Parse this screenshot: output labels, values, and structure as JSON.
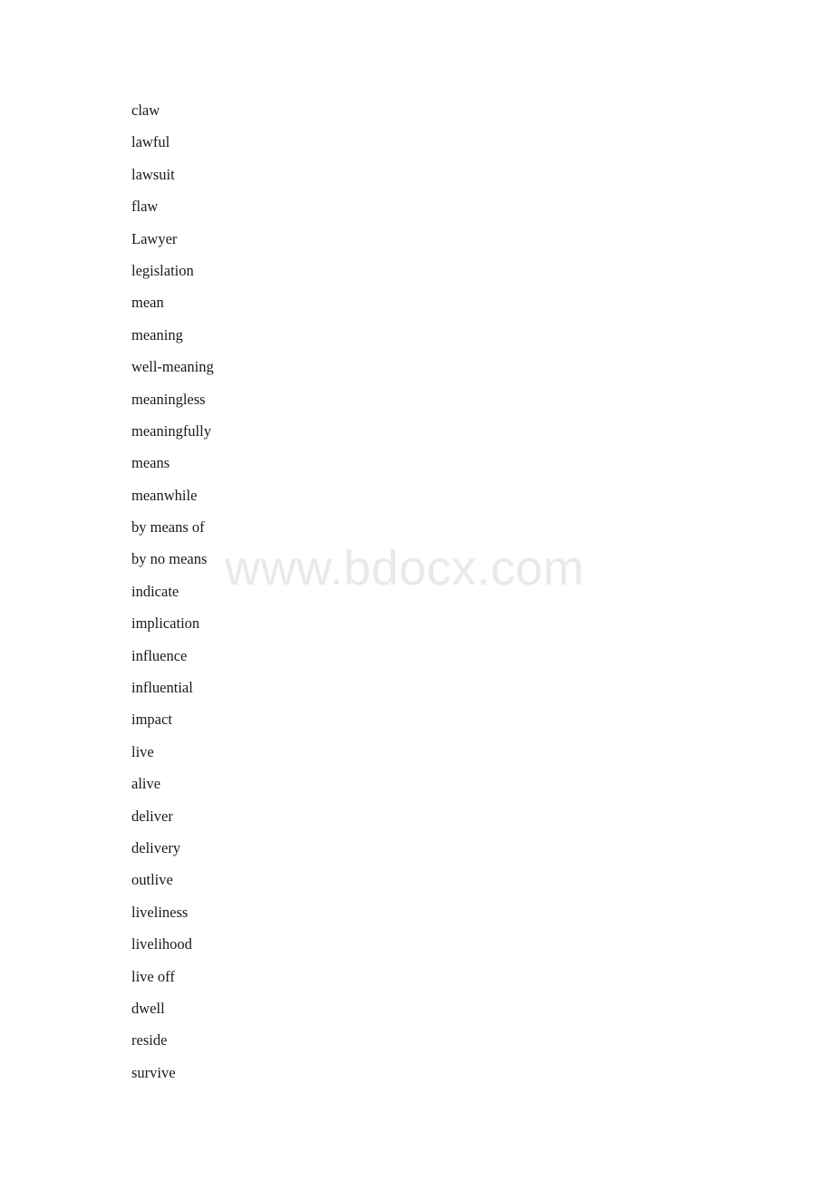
{
  "document": {
    "page_background": "#ffffff",
    "text_color": "#1a1a1a",
    "watermark_color": "#e9e9e9"
  },
  "watermark": {
    "text": "www.bdocx.com"
  },
  "word_list": {
    "items": [
      "claw",
      "lawful",
      "lawsuit",
      "flaw",
      "Lawyer",
      "legislation",
      "mean",
      "meaning",
      "well-meaning",
      "meaningless",
      "meaningfully",
      "means",
      "meanwhile",
      "by means of",
      "by no means",
      "indicate",
      "implication",
      "influence",
      "influential",
      "impact",
      "live",
      "alive",
      "deliver",
      "delivery",
      "outlive",
      "liveliness",
      "livelihood",
      "live off",
      "dwell",
      "reside",
      "survive"
    ]
  }
}
